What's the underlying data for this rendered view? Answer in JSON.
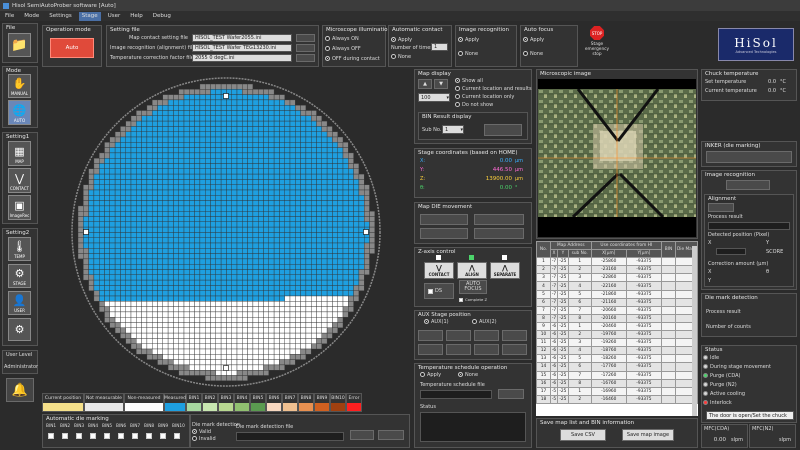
{
  "window": {
    "title": "Hisol SemiAutoProber software [Auto]"
  },
  "menu": [
    {
      "label": "File",
      "active": false
    },
    {
      "label": "Mode",
      "active": false
    },
    {
      "label": "Settings",
      "active": false
    },
    {
      "label": "Stage",
      "active": true
    },
    {
      "label": "User",
      "active": false
    },
    {
      "label": "Help",
      "active": false
    },
    {
      "label": "Debug",
      "active": false
    }
  ],
  "sidebar": {
    "file_title": "File",
    "mode_title": "Mode",
    "setting1_title": "Setting1",
    "setting2_title": "Setting2",
    "mode_buttons": [
      {
        "label": "MANUAL"
      },
      {
        "label": "AUTO"
      }
    ],
    "setting1_buttons": [
      {
        "label": "MAP"
      },
      {
        "label": "CONTACT"
      },
      {
        "label": "ImageRec"
      }
    ],
    "setting2_buttons": [
      {
        "label": "TEMP"
      },
      {
        "label": "STAGE"
      },
      {
        "label": "USER"
      },
      {
        "label": ""
      }
    ],
    "user_level_label": "User Level",
    "user_level_value": "Administrator"
  },
  "operation_mode": {
    "title": "Operation mode",
    "button": "Auto"
  },
  "setting_file": {
    "title": "Setting file",
    "rows": [
      {
        "label": "Map contact setting file",
        "value": "HISOL_TEST Wafer2055.ini"
      },
      {
        "label": "Image recognition (alignment) files",
        "value": "HISOL_TEST Wafer TEG13230.ini"
      },
      {
        "label": "Temperature correction factor file",
        "value": "2055 0 degC.ini"
      }
    ]
  },
  "illumination": {
    "title": "Microscope illumination",
    "options": [
      {
        "label": "Always ON",
        "on": false
      },
      {
        "label": "Always OFF",
        "on": false
      },
      {
        "label": "OFF during contact",
        "on": true
      }
    ]
  },
  "auto_contact": {
    "title": "Automatic contact",
    "apply": "Apply",
    "times_label": "Number of times",
    "times_value": "1",
    "none": "None"
  },
  "image_recognition_top": {
    "title": "Image recognition",
    "apply": "Apply",
    "none": "None"
  },
  "auto_focus": {
    "title": "Auto focus",
    "apply": "Apply",
    "none": "None"
  },
  "emergency": {
    "sign": "STOP",
    "label": "Stage emergency stop"
  },
  "logo": {
    "text": "HiSol",
    "sub": "Advanced Technologies"
  },
  "map_display": {
    "title": "Map display",
    "zoom_value": "100",
    "options": [
      {
        "label": "Show all",
        "on": true
      },
      {
        "label": "Current location and results",
        "on": false
      },
      {
        "label": "Current location only",
        "on": false
      },
      {
        "label": "Do not show",
        "on": false
      }
    ],
    "bin_title": "BIN Result display",
    "sub_label": "Sub No.",
    "sub_value": "1"
  },
  "stage_coords": {
    "title": "Stage coordinates (based on HOME)",
    "rows": [
      {
        "axis": "X:",
        "value": "0.00",
        "unit": "μm",
        "color": "#3ab0ff"
      },
      {
        "axis": "Y:",
        "value": "446.50",
        "unit": "μm",
        "color": "#ff6ad5"
      },
      {
        "axis": "Z:",
        "value": "13900.00",
        "unit": "μm",
        "color": "#ffd23c"
      },
      {
        "axis": "θ:",
        "value": "0.00",
        "unit": "°",
        "color": "#4cd46b"
      }
    ]
  },
  "map_die_move": {
    "title": "Map DIE movement"
  },
  "z_axis": {
    "title": "Z-axis control",
    "buttons": [
      "CONTACT",
      "ALIGN",
      "SEPARATE"
    ],
    "ds_label": "DS",
    "autofocus": "AUTO FOCUS",
    "complete": "Complete Z"
  },
  "aux_stage": {
    "title": "AUX Stage position",
    "options": [
      {
        "label": "AUX(1)",
        "on": true
      },
      {
        "label": "AUX(2)",
        "on": false
      }
    ]
  },
  "temp_schedule": {
    "title": "Temperature schedule operation",
    "apply": "Apply",
    "none": "None",
    "file_label": "Temperature schedule file",
    "status_label": "Status"
  },
  "microscope": {
    "title": "Microscopic image"
  },
  "die_table": {
    "group_header_addr": "Map Address",
    "group_header_coord": "Use coordinates from HI",
    "headers": [
      "No.",
      "X",
      "Y",
      "sub No.",
      "X[μm]",
      "Y[μm]",
      "BIN",
      "Die Mark"
    ],
    "rows": [
      [
        "1",
        "-7",
        "-25",
        "1",
        "-25860",
        "-93375",
        "",
        ""
      ],
      [
        "2",
        "-7",
        "-25",
        "2",
        "-23160",
        "-93375",
        "",
        ""
      ],
      [
        "3",
        "-7",
        "-25",
        "3",
        "-22860",
        "-93375",
        "",
        ""
      ],
      [
        "4",
        "-7",
        "-25",
        "4",
        "-22160",
        "-93375",
        "",
        ""
      ],
      [
        "5",
        "-7",
        "-25",
        "5",
        "-21860",
        "-93375",
        "",
        ""
      ],
      [
        "6",
        "-7",
        "-25",
        "6",
        "-21160",
        "-93375",
        "",
        ""
      ],
      [
        "7",
        "-7",
        "-25",
        "7",
        "-20660",
        "-93375",
        "",
        ""
      ],
      [
        "8",
        "-7",
        "-25",
        "8",
        "-20160",
        "-93375",
        "",
        ""
      ],
      [
        "9",
        "-6",
        "-25",
        "1",
        "-20460",
        "-93375",
        "",
        ""
      ],
      [
        "10",
        "-6",
        "-25",
        "2",
        "-19760",
        "-93375",
        "",
        ""
      ],
      [
        "11",
        "-6",
        "-25",
        "3",
        "-19260",
        "-93375",
        "",
        ""
      ],
      [
        "12",
        "-6",
        "-25",
        "4",
        "-18760",
        "-93375",
        "",
        ""
      ],
      [
        "13",
        "-6",
        "-25",
        "5",
        "-18260",
        "-93375",
        "",
        ""
      ],
      [
        "14",
        "-6",
        "-25",
        "6",
        "-17760",
        "-93375",
        "",
        ""
      ],
      [
        "15",
        "-6",
        "-25",
        "7",
        "-17260",
        "-93375",
        "",
        ""
      ],
      [
        "16",
        "-6",
        "-25",
        "8",
        "-16760",
        "-93375",
        "",
        ""
      ],
      [
        "17",
        "-5",
        "-25",
        "1",
        "-16960",
        "-93375",
        "",
        ""
      ],
      [
        "18",
        "-5",
        "-25",
        "2",
        "-16460",
        "-93375",
        "",
        ""
      ]
    ]
  },
  "save_panel": {
    "title": "Save map list and BIN information",
    "save_csv": "Save CSV",
    "save_map": "Save map image"
  },
  "chuck_temp": {
    "title": "Chuck temperature",
    "rows": [
      {
        "label": "Set temperature",
        "value": "0.0",
        "unit": "°C"
      },
      {
        "label": "Current temperature",
        "value": "0.0",
        "unit": "°C"
      }
    ]
  },
  "inker": {
    "title": "INKER (die marking)"
  },
  "image_recognition_right": {
    "title": "Image recognition",
    "alignment_title": "Alignment",
    "process_result": "Process result",
    "detected_position": "Detected position (Pixel)",
    "x": "X",
    "y": "Y",
    "score": "SCORE",
    "correction": "Correction amount (μm)",
    "theta": "θ"
  },
  "die_mark_detection_right": {
    "title": "Die mark detection",
    "process_result": "Process result",
    "count": "Number of counts"
  },
  "status": {
    "title": "Status",
    "items": [
      {
        "label": "Idle",
        "color": "#d8d8d8"
      },
      {
        "label": "During stage movement",
        "color": "#d8d8d8"
      },
      {
        "label": "Purge (CDA)",
        "color": "#4cd46b"
      },
      {
        "label": "Purge (N2)",
        "color": "#d8d8d8"
      },
      {
        "label": "Active cooling",
        "color": "#d8d8d8"
      },
      {
        "label": "Interlock",
        "color": "#ff3b3b"
      }
    ],
    "message": "The door is open/Set the chuck"
  },
  "mfc": [
    {
      "label": "MFC(CDA)",
      "value": "0.00",
      "unit": "slpm"
    },
    {
      "label": "MFC(N2)",
      "value": "",
      "unit": "slpm"
    }
  ],
  "legend": [
    {
      "label": "Current position",
      "color": "#f5e08a"
    },
    {
      "label": "Not measurable",
      "color": "#e8e8e8"
    },
    {
      "label": "Non-measured",
      "color": "#ffffff"
    },
    {
      "label": "Measured",
      "color": "#1e9fe0"
    },
    {
      "label": "BIN1",
      "color": "#a8d8a0"
    },
    {
      "label": "BIN2",
      "color": "#c8e6b0"
    },
    {
      "label": "BIN3",
      "color": "#b8d890"
    },
    {
      "label": "BIN4",
      "color": "#90c070"
    },
    {
      "label": "BIN5",
      "color": "#5a9a50"
    },
    {
      "label": "BIN6",
      "color": "#f8d8c0"
    },
    {
      "label": "BIN7",
      "color": "#f0c090"
    },
    {
      "label": "BIN8",
      "color": "#e89050"
    },
    {
      "label": "BIN9",
      "color": "#d06020"
    },
    {
      "label": "BIN10",
      "color": "#a04010"
    },
    {
      "label": "Error",
      "color": "#ff2020"
    }
  ],
  "auto_die_marking": {
    "title": "Automatic die marking",
    "bins": [
      "BIN1",
      "BIN2",
      "BIN3",
      "BIN4",
      "BIN5",
      "BIN6",
      "BIN7",
      "BIN8",
      "BIN9",
      "BIN10"
    ],
    "detect_title": "Die mark detection",
    "valid": "Valid",
    "invalid": "Invalid",
    "file_label": "Die mark detection file"
  }
}
